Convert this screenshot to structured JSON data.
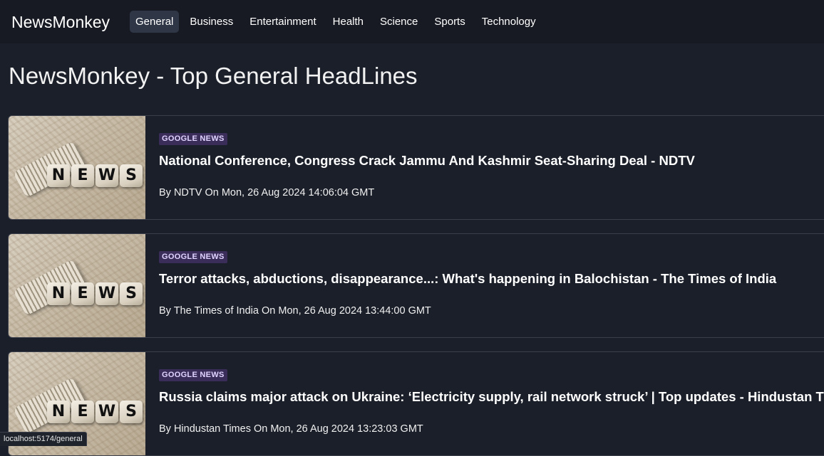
{
  "navbar": {
    "brand": "NewsMonkey",
    "links": [
      {
        "label": "General",
        "active": true
      },
      {
        "label": "Business"
      },
      {
        "label": "Entertainment"
      },
      {
        "label": "Health"
      },
      {
        "label": "Science"
      },
      {
        "label": "Sports"
      },
      {
        "label": "Technology"
      }
    ]
  },
  "page": {
    "title": "NewsMonkey - Top General HeadLines"
  },
  "articles": [
    {
      "source": "GOOGLE NEWS",
      "title": "National Conference, Congress Crack Jammu And Kashmir Seat-Sharing Deal - NDTV",
      "meta": "By NDTV On Mon, 26 Aug 2024 14:06:04 GMT",
      "image_text": [
        "N",
        "E",
        "W",
        "S"
      ]
    },
    {
      "source": "GOOGLE NEWS",
      "title": "Terror attacks, abductions, disappearance...: What's happening in Balochistan - The Times of India",
      "meta": "By The Times of India On Mon, 26 Aug 2024 13:44:00 GMT",
      "image_text": [
        "N",
        "E",
        "W",
        "S"
      ]
    },
    {
      "source": "GOOGLE NEWS",
      "title": "Russia claims major attack on Ukraine: ‘Electricity supply, rail network struck’ | Top updates - Hindustan Times",
      "meta": "By Hindustan Times On Mon, 26 Aug 2024 13:23:03 GMT",
      "image_text": [
        "N",
        "E",
        "W",
        "S"
      ]
    }
  ],
  "status_bar": {
    "url": "localhost:5174/general"
  }
}
